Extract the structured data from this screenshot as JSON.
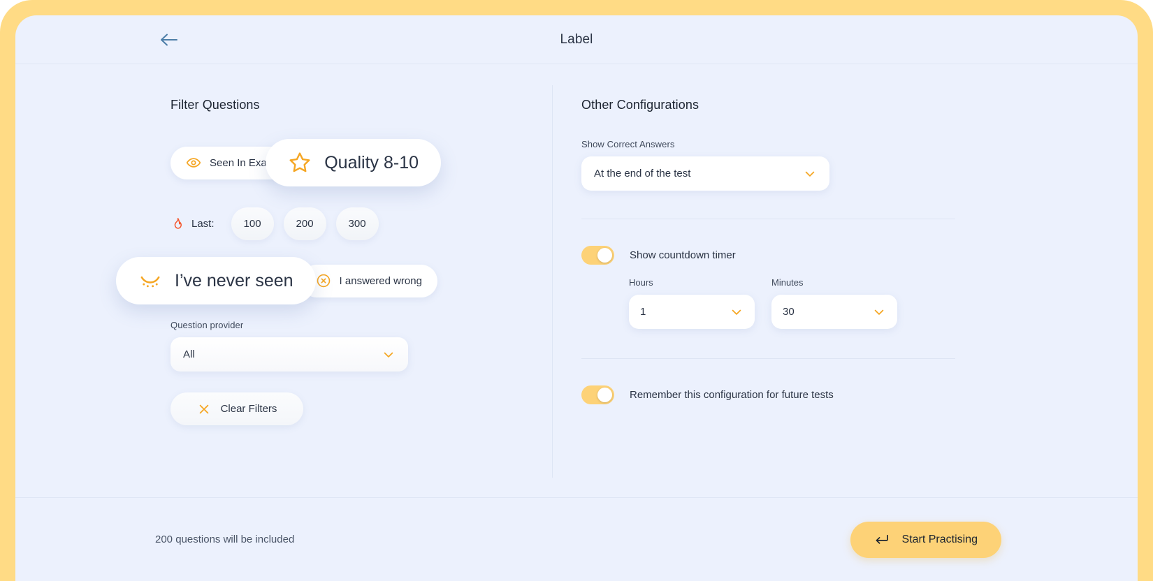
{
  "theme": {
    "frame_color": "#ffdb85",
    "app_background": "#ecf1fd",
    "accent": "#f5a623",
    "accent_soft": "#fdd277",
    "flame_color": "#f4542a",
    "text_primary": "#2b3445",
    "divider": "#dde5f4"
  },
  "header": {
    "title": "Label",
    "back_icon": "arrow-left-icon"
  },
  "filters": {
    "section_title": "Filter Questions",
    "chips": [
      {
        "label": "Seen In Exam",
        "icon": "eye-open-icon",
        "emphasized": false
      },
      {
        "label": "Quality 8-10",
        "icon": "star-icon",
        "emphasized": true
      }
    ],
    "last": {
      "icon": "flame-icon",
      "label": "Last:",
      "options": [
        "100",
        "200",
        "300"
      ]
    },
    "seen_chips": [
      {
        "label": "I’ve never seen",
        "icon": "eye-closed-icon",
        "emphasized": true
      },
      {
        "label": "I answered wrong",
        "icon": "x-circle-icon",
        "emphasized": false
      }
    ],
    "provider": {
      "label": "Question provider",
      "value": "All",
      "chevron": "chevron-down-icon"
    },
    "clear": {
      "label": "Clear Filters",
      "icon": "x-icon"
    }
  },
  "config": {
    "section_title": "Other Configurations",
    "show_correct_answers": {
      "label": "Show Correct Answers",
      "value": "At the end of the test",
      "chevron": "chevron-down-icon"
    },
    "countdown": {
      "label": "Show countdown timer",
      "enabled": true,
      "hours": {
        "label": "Hours",
        "value": "1",
        "chevron": "chevron-down-icon"
      },
      "minutes": {
        "label": "Minutes",
        "value": "30",
        "chevron": "chevron-down-icon"
      }
    },
    "remember": {
      "label": "Remember this configuration for future tests",
      "enabled": true
    }
  },
  "footer": {
    "note": "200 questions will be included",
    "start_label": "Start Practising",
    "start_icon": "enter-key-icon"
  }
}
